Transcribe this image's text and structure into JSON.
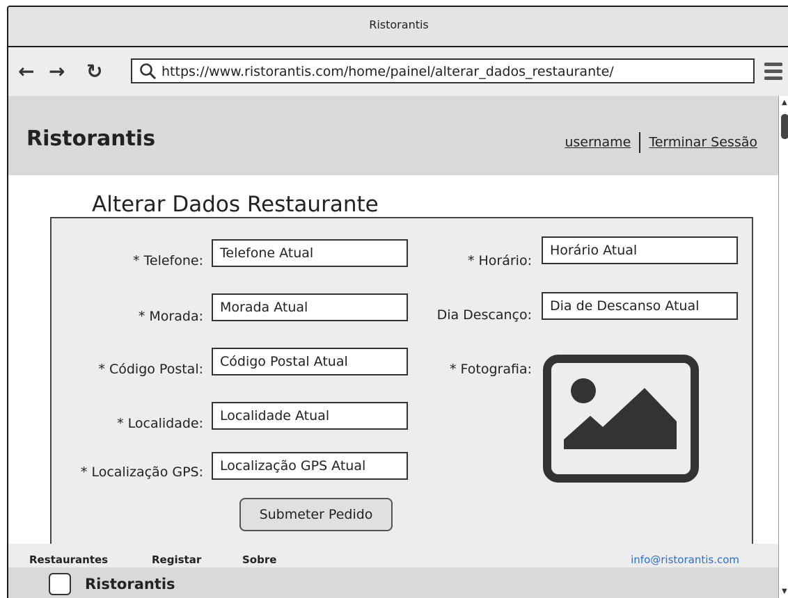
{
  "window": {
    "title": "Ristorantis"
  },
  "browser": {
    "url": "https://www.ristorantis.com/home/painel/alterar_dados_restaurante/",
    "back_icon": "arrow-left-icon",
    "forward_icon": "arrow-right-icon",
    "reload_icon": "reload-icon"
  },
  "header": {
    "brand": "Ristorantis",
    "username": "username",
    "logout": "Terminar Sessão"
  },
  "page": {
    "title": "Alterar Dados Restaurante"
  },
  "form": {
    "telefone": {
      "label": "* Telefone:",
      "value": "Telefone Atual"
    },
    "morada": {
      "label": "* Morada:",
      "value": "Morada Atual"
    },
    "codigo_postal": {
      "label": "* Código Postal:",
      "value": "Código Postal Atual"
    },
    "localidade": {
      "label": "* Localidade:",
      "value": "Localidade Atual"
    },
    "gps": {
      "label": "* Localização GPS:",
      "value": "Localização GPS Atual"
    },
    "horario": {
      "label": "* Horário:",
      "value": "Horário Atual"
    },
    "descanso": {
      "label": "Dia Descanço:",
      "value": "Dia de Descanso Atual"
    },
    "fotografia": {
      "label": "* Fotografia:"
    },
    "submit": "Submeter Pedido"
  },
  "footer": {
    "links": [
      "Restaurantes",
      "Registar",
      "Sobre"
    ],
    "email": "info@ristorantis.com",
    "brand": "Ristorantis"
  },
  "colors": {
    "link_blue": "#2a6fd6",
    "header_gray": "#d9d9d9",
    "form_gray": "#ededed"
  }
}
